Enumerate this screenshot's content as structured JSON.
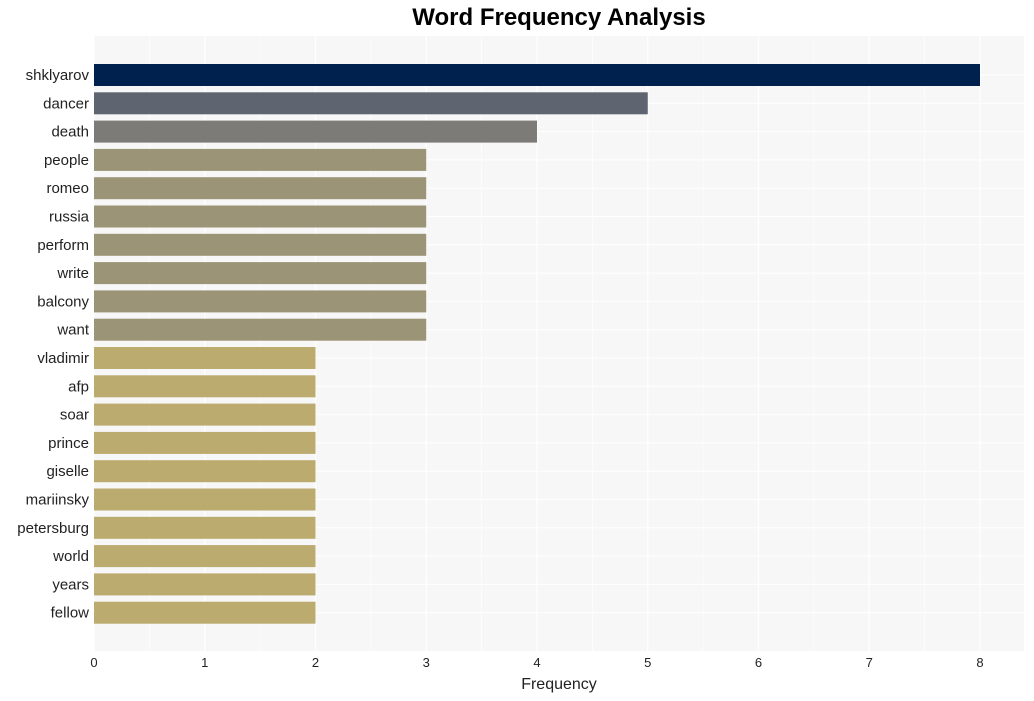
{
  "chart_data": {
    "type": "bar",
    "orientation": "horizontal",
    "title": "Word Frequency Analysis",
    "xlabel": "Frequency",
    "ylabel": "",
    "xlim": [
      0,
      8.4
    ],
    "xticks": [
      0,
      1,
      2,
      3,
      4,
      5,
      6,
      7,
      8
    ],
    "grid": true,
    "categories": [
      "shklyarov",
      "dancer",
      "death",
      "people",
      "romeo",
      "russia",
      "perform",
      "write",
      "balcony",
      "want",
      "vladimir",
      "afp",
      "soar",
      "prince",
      "giselle",
      "mariinsky",
      "petersburg",
      "world",
      "years",
      "fellow"
    ],
    "values": [
      8,
      5,
      4,
      3,
      3,
      3,
      3,
      3,
      3,
      3,
      2,
      2,
      2,
      2,
      2,
      2,
      2,
      2,
      2,
      2
    ],
    "colors": [
      "#00214d",
      "#5e6470",
      "#7c7b78",
      "#9b9476",
      "#9b9476",
      "#9b9476",
      "#9b9476",
      "#9b9476",
      "#9b9476",
      "#9b9476",
      "#bbab6e",
      "#bbab6e",
      "#bbab6e",
      "#bbab6e",
      "#bbab6e",
      "#bbab6e",
      "#bbab6e",
      "#bbab6e",
      "#bbab6e",
      "#bbab6e"
    ],
    "plot_background": "#f7f7f7"
  }
}
